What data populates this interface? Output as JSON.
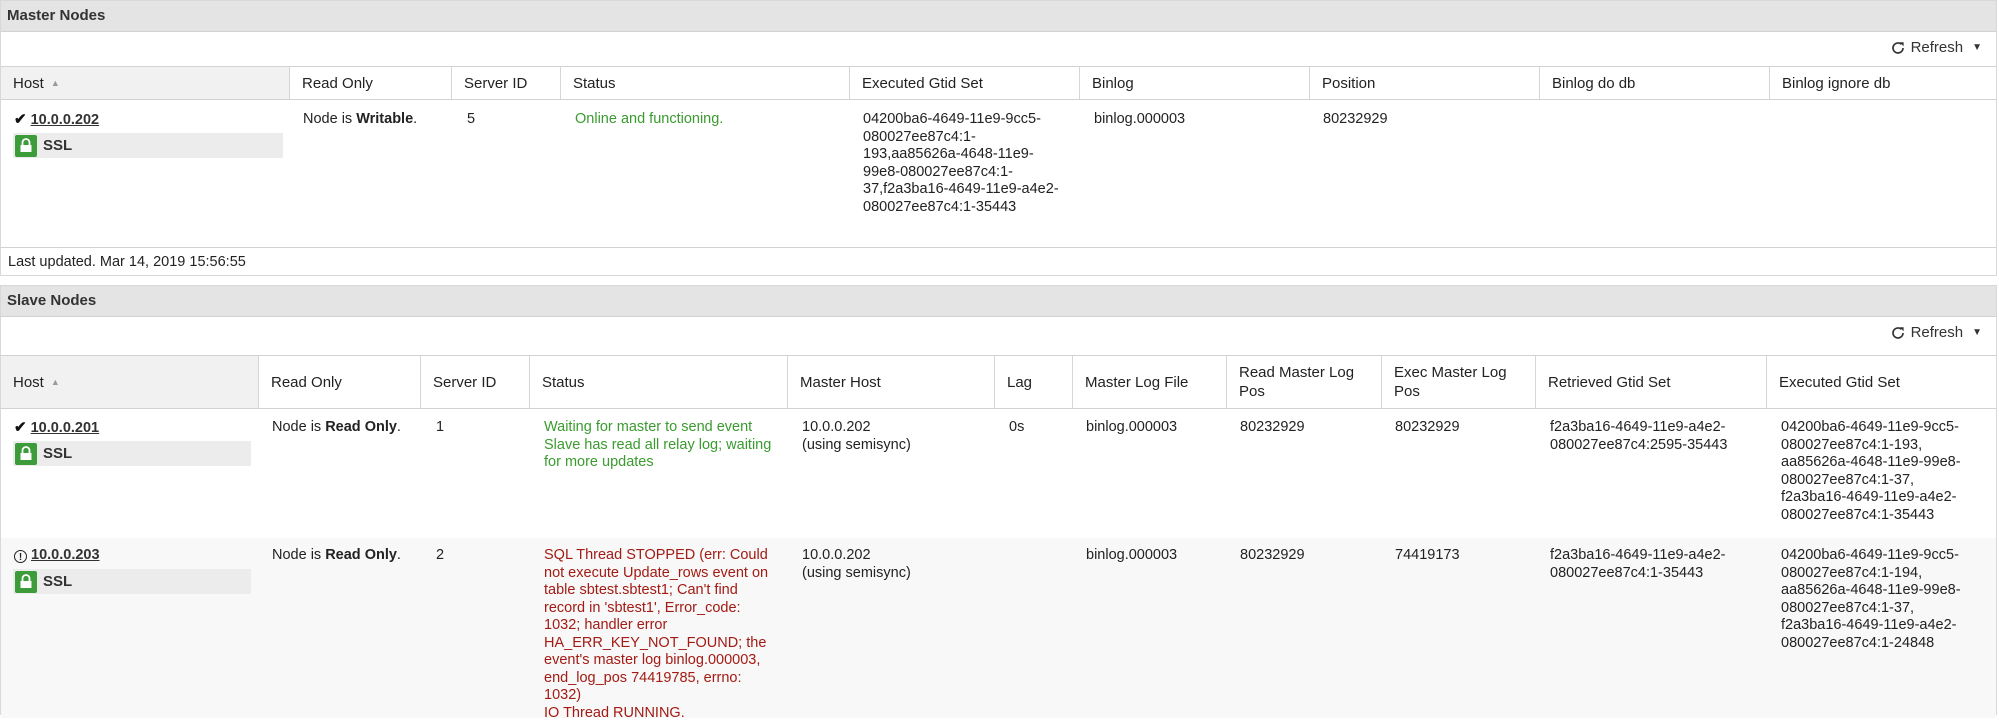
{
  "master": {
    "title": "Master Nodes",
    "refresh_label": "Refresh",
    "columns": [
      "Host",
      "Read Only",
      "Server ID",
      "Status",
      "Executed Gtid Set",
      "Binlog",
      "Position",
      "Binlog do db",
      "Binlog ignore db"
    ],
    "rows": [
      {
        "host": "10.0.0.202",
        "ssl_label": "SSL",
        "read_only_prefix": "Node is ",
        "read_only_value": "Writable",
        "read_only_suffix": ".",
        "server_id": "5",
        "status": "Online and functioning.",
        "executed_gtid_lines": [
          "04200ba6-4649-11e9-9cc5-",
          "080027ee87c4:1-",
          "193,aa85626a-4648-11e9-",
          "99e8-080027ee87c4:1-",
          "37,f2a3ba16-4649-11e9-a4e2-",
          "080027ee87c4:1-35443"
        ],
        "binlog": "binlog.000003",
        "position": "80232929"
      }
    ],
    "last_updated": "Last updated. Mar 14, 2019 15:56:55"
  },
  "slave": {
    "title": "Slave Nodes",
    "refresh_label": "Refresh",
    "columns": [
      "Host",
      "Read Only",
      "Server ID",
      "Status",
      "Master Host",
      "Lag",
      "Master Log File",
      "Read Master Log\nPos",
      "Exec Master Log\nPos",
      "Retrieved Gtid Set",
      "Executed Gtid Set"
    ],
    "rows": [
      {
        "host": "10.0.0.201",
        "ssl_label": "SSL",
        "read_only_prefix": "Node is ",
        "read_only_value": "Read Only",
        "read_only_suffix": ".",
        "server_id": "1",
        "status_lines": [
          "Waiting for master to send event",
          "Slave has read all relay log; waiting",
          "for more updates"
        ],
        "master_host_lines": [
          "10.0.0.202",
          "(using semisync)"
        ],
        "lag": "0s",
        "master_log_file": "binlog.000003",
        "read_master_log_pos": "80232929",
        "exec_master_log_pos": "80232929",
        "retrieved_gtid_lines": [
          "f2a3ba16-4649-11e9-a4e2-",
          "080027ee87c4:2595-35443"
        ],
        "executed_gtid_lines": [
          "04200ba6-4649-11e9-9cc5-",
          "080027ee87c4:1-193,",
          "aa85626a-4648-11e9-99e8-",
          "080027ee87c4:1-37,",
          "f2a3ba16-4649-11e9-a4e2-",
          "080027ee87c4:1-35443"
        ]
      },
      {
        "host": "10.0.0.203",
        "ssl_label": "SSL",
        "read_only_prefix": "Node is ",
        "read_only_value": "Read Only",
        "read_only_suffix": ".",
        "server_id": "2",
        "status_lines": [
          "SQL Thread STOPPED (err: Could",
          "not execute Update_rows event on",
          "table sbtest.sbtest1; Can't find",
          "record in 'sbtest1', Error_code:",
          "1032; handler error",
          "HA_ERR_KEY_NOT_FOUND; the",
          "event's master log binlog.000003,",
          "end_log_pos 74419785, errno:",
          "1032)",
          "IO Thread RUNNING."
        ],
        "master_host_lines": [
          "10.0.0.202",
          "(using semisync)"
        ],
        "lag": "",
        "master_log_file": "binlog.000003",
        "read_master_log_pos": "80232929",
        "exec_master_log_pos": "74419173",
        "retrieved_gtid_lines": [
          "f2a3ba16-4649-11e9-a4e2-",
          "080027ee87c4:1-35443"
        ],
        "executed_gtid_lines": [
          "04200ba6-4649-11e9-9cc5-",
          "080027ee87c4:1-194,",
          "aa85626a-4648-11e9-99e8-",
          "080027ee87c4:1-37,",
          "f2a3ba16-4649-11e9-a4e2-",
          "080027ee87c4:1-24848"
        ]
      }
    ]
  },
  "colors": {
    "ok": "#3a9b2f",
    "error": "#a21b14",
    "ssl_lock": "#3c9c3a",
    "header_bg": "#e4e4e4"
  }
}
